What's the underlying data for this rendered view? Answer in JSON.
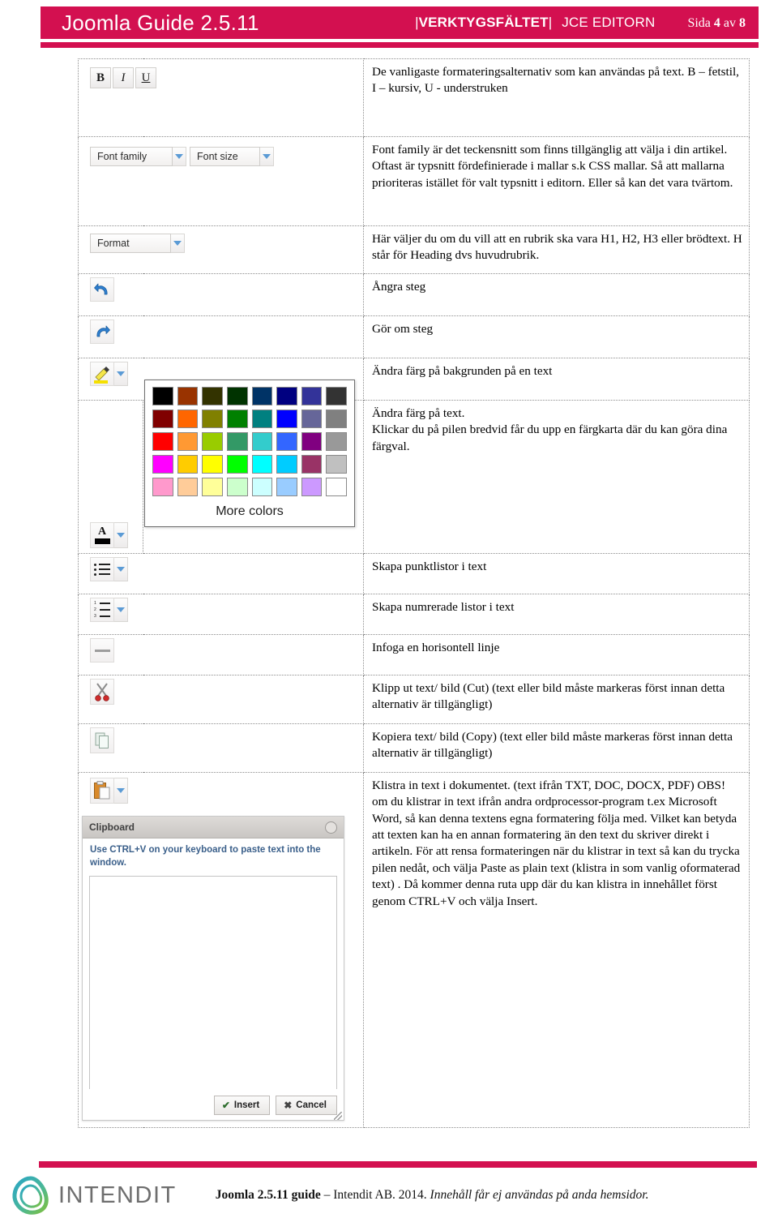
{
  "header": {
    "title": "Joomla Guide 2.5.11",
    "section_left_pipe": "|",
    "section": "VERKTYGSFÄLTET",
    "section_right_pipe": "|",
    "editor": "JCE EDITORN",
    "page_prefix": "Sida",
    "page_number": "4",
    "page_of": "av",
    "page_total": "8",
    "band_color": "#d31050",
    "text_color": "#ffffff"
  },
  "toolbar": {
    "bold_label": "B",
    "italic_label": "I",
    "underline_label": "U",
    "font_family_label": "Font family",
    "font_size_label": "Font size",
    "format_label": "Format",
    "more_colors_label": "More colors"
  },
  "rows": [
    {
      "icon": "bold-italic-underline-buttons",
      "text": "De vanligaste formateringsalternativ som kan användas på text. B – fetstil, I – kursiv, U - understruken"
    },
    {
      "icon": "font-family-and-size-dropdowns",
      "text": "Font family är det teckensnitt som finns tillgänglig att välja i din artikel. Oftast är typsnitt fördefinierade i mallar s.k CSS mallar. Så att mallarna prioriteras istället för valt typsnitt i editorn. Eller så kan det vara tvärtom."
    },
    {
      "icon": "format-dropdown",
      "text": "Här väljer du om du vill att en rubrik ska vara H1, H2, H3 eller brödtext. H står för Heading dvs huvudrubrik."
    },
    {
      "icon": "undo-icon",
      "text": "Ångra steg"
    },
    {
      "icon": "redo-icon",
      "text": "Gör om steg"
    },
    {
      "icon": "highlight-pen-icon",
      "text": "Ändra färg på bakgrunden på en text"
    },
    {
      "icon": "font-color-icon",
      "text": "Ändra färg på text.\nKlickar du på pilen bredvid får du upp en färgkarta där du kan göra dina färgval."
    },
    {
      "icon": "bullet-list-icon",
      "text": "Skapa punktlistor i text"
    },
    {
      "icon": "numbered-list-icon",
      "text": "Skapa numrerade listor i text"
    },
    {
      "icon": "horizontal-rule-icon",
      "text": "Infoga en horisontell linje"
    },
    {
      "icon": "cut-scissors-icon",
      "text": "Klipp ut text/ bild (Cut) (text eller bild måste markeras först innan detta alternativ är tillgängligt)"
    },
    {
      "icon": "copy-icon",
      "text": "Kopiera text/ bild (Copy) (text eller bild måste markeras först innan detta alternativ är tillgängligt)"
    },
    {
      "icon": "paste-icon",
      "text": "Klistra in text i dokumentet. (text ifrån TXT, DOC, DOCX, PDF)\nOBS! om du klistrar in text ifrån andra ordprocessor-program t.ex Microsoft Word, så kan denna textens egna formatering följa med. Vilket kan betyda att texten kan ha en annan formatering än den text du skriver direkt i artikeln. För att rensa formateringen när du klistrar in text så kan du trycka pilen nedåt, och välja Paste as plain text (klistra in som vanlig oformaterad text) . Då kommer    denna ruta upp där du kan klistra in innehållet först genom CTRL+V och välja Insert."
    }
  ],
  "row_texts": {
    "r1": "De vanligaste formateringsalternativ som kan användas på text. B – fetstil, I – kursiv, U - understruken",
    "r2": "Font family är det teckensnitt som finns tillgänglig att välja i din artikel. Oftast är typsnitt fördefinierade i mallar s.k CSS mallar. Så att mallarna prioriteras istället för valt typsnitt i editorn. Eller så kan det vara tvärtom.",
    "r3": "Här väljer du om du vill att en rubrik ska vara H1, H2, H3 eller brödtext. H står för Heading dvs huvudrubrik.",
    "r4": "Ångra steg",
    "r5": "Gör om steg",
    "r6": "Ändra färg på bakgrunden på en text",
    "r7a": "Ändra färg på text.",
    "r7b": "Klickar du på pilen bredvid får du upp en färgkarta där du kan göra dina färgval.",
    "r8": "Skapa punktlistor i text",
    "r9": "Skapa numrerade listor i text",
    "r10": "Infoga en horisontell linje",
    "r11": "Klipp ut text/ bild (Cut) (text eller bild måste markeras först innan detta alternativ är tillgängligt)",
    "r12": "Kopiera text/ bild (Copy) (text eller bild måste markeras först innan detta alternativ är tillgängligt)",
    "r13": "Klistra in text i dokumentet. (text ifrån TXT, DOC, DOCX, PDF) OBS! om du klistrar in text ifrån andra ordprocessor-program t.ex Microsoft Word, så kan denna textens egna formatering följa med. Vilket kan betyda att texten kan ha en annan formatering än den text du skriver direkt i artikeln. För att rensa formateringen när du klistrar in text så kan du trycka pilen nedåt, och välja Paste as plain text (klistra in som vanlig oformaterad text) . Då kommer    denna ruta upp där du kan klistra in innehållet först genom CTRL+V och välja Insert."
  },
  "color_picker": {
    "more_colors_label": "More colors",
    "swatches": [
      [
        "#000000",
        "#993300",
        "#333300",
        "#003300",
        "#003366",
        "#000080",
        "#333399",
        "#333333"
      ],
      [
        "#800000",
        "#FF6600",
        "#808000",
        "#008000",
        "#008080",
        "#0000FF",
        "#666699",
        "#808080"
      ],
      [
        "#FF0000",
        "#FF9933",
        "#99CC00",
        "#339966",
        "#33CCCC",
        "#3366FF",
        "#800080",
        "#999999"
      ],
      [
        "#FF00FF",
        "#FFCC00",
        "#FFFF00",
        "#00FF00",
        "#00FFFF",
        "#00CCFF",
        "#993366",
        "#C0C0C0"
      ],
      [
        "#FF99CC",
        "#FFCC99",
        "#FFFF99",
        "#CCFFCC",
        "#CCFFFF",
        "#99CCFF",
        "#CC99FF",
        "#FFFFFF"
      ]
    ]
  },
  "clipboard_dialog": {
    "title": "Clipboard",
    "hint": "Use CTRL+V on your keyboard to paste text into the window.",
    "insert_label": "Insert",
    "cancel_label": "Cancel",
    "textarea_value": ""
  },
  "footer": {
    "logo_text": "INTENDIT",
    "credit_bold": "Joomla 2.5.11 guide",
    "credit_normal": " – Intendit AB. 2014. ",
    "credit_italic": "Innehåll får ej användas på anda hemsidor.",
    "rule_color": "#d31050"
  }
}
